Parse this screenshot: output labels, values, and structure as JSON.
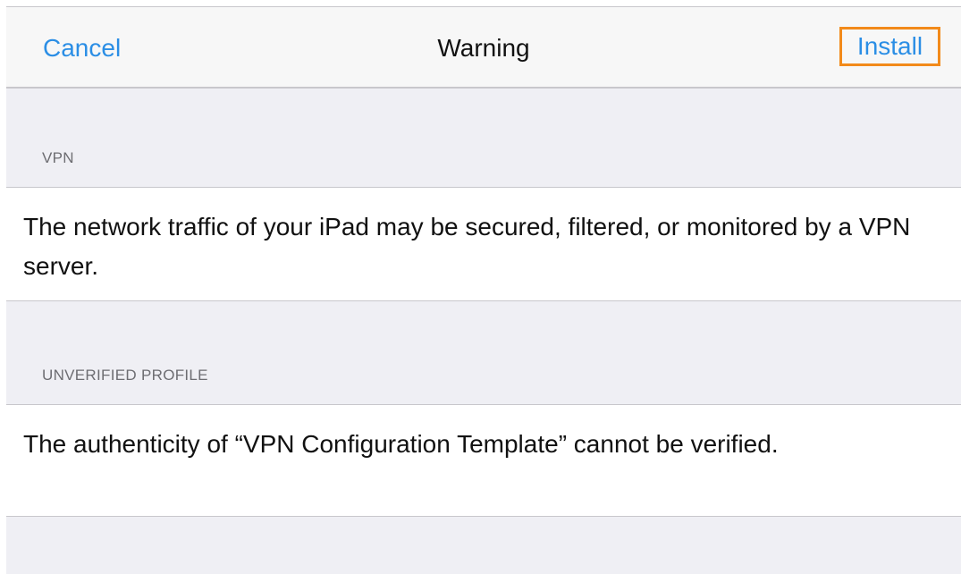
{
  "navbar": {
    "cancel_label": "Cancel",
    "title": "Warning",
    "install_label": "Install"
  },
  "sections": [
    {
      "header": "VPN",
      "body": "The network traffic of your iPad may be secured, filtered, or monitored by a VPN server."
    },
    {
      "header": "UNVERIFIED PROFILE",
      "body": "The authenticity of “VPN Configuration Template” cannot be verified."
    }
  ],
  "colors": {
    "accent": "#2b8ee5",
    "highlight_border": "#f28a1a",
    "grouped_background": "#efeff4"
  }
}
